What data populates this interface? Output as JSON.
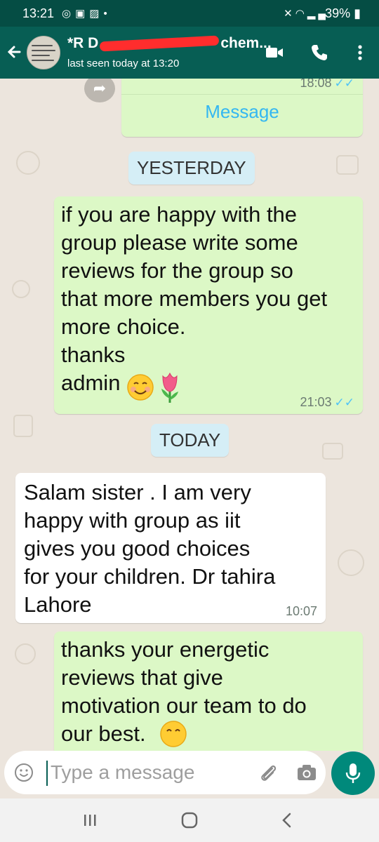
{
  "status_bar": {
    "time": "13:21",
    "left_icons": [
      "whatsapp-icon",
      "gallery-icon",
      "image-icon",
      "dot-icon"
    ],
    "right_icons": [
      "mute-icon",
      "wifi-icon",
      "signal-icon"
    ],
    "battery": "39%"
  },
  "header": {
    "title_start": "*R D",
    "title_end": "chem...",
    "subtitle": "last seen today at 13:20"
  },
  "chat": {
    "partial_card": {
      "time": "18:08",
      "action_label": "Message"
    },
    "date_yesterday": "YESTERDAY",
    "msg_admin": {
      "text": "if you are happy with the\ngroup please write some\nreviews for the group so\nthat more members you get\nmore choice.\nthanks",
      "signature": "admin",
      "emojis": [
        "smiling-face-emoji",
        "tulip-emoji"
      ],
      "time": "21:03"
    },
    "date_today": "TODAY",
    "msg_incoming": {
      "text": "Salam sister . I am very\nhappy with group as iit\ngives you good choices\nfor your children. Dr tahira\nLahore",
      "time": "10:07"
    },
    "msg_reply": {
      "text": "thanks your energetic\nreviews that give\nmotivation our team to do\nour best."
    }
  },
  "input": {
    "placeholder": "Type a message"
  },
  "colors": {
    "header": "#075E54",
    "status_bar": "#054D44",
    "outgoing": "#DCF8C6",
    "incoming": "#FFFFFF",
    "date_chip": "#D5EEF6",
    "mic": "#00897B",
    "read_tick": "#4FC3F7"
  },
  "nav": [
    "recents-icon",
    "home-icon",
    "back-icon"
  ]
}
